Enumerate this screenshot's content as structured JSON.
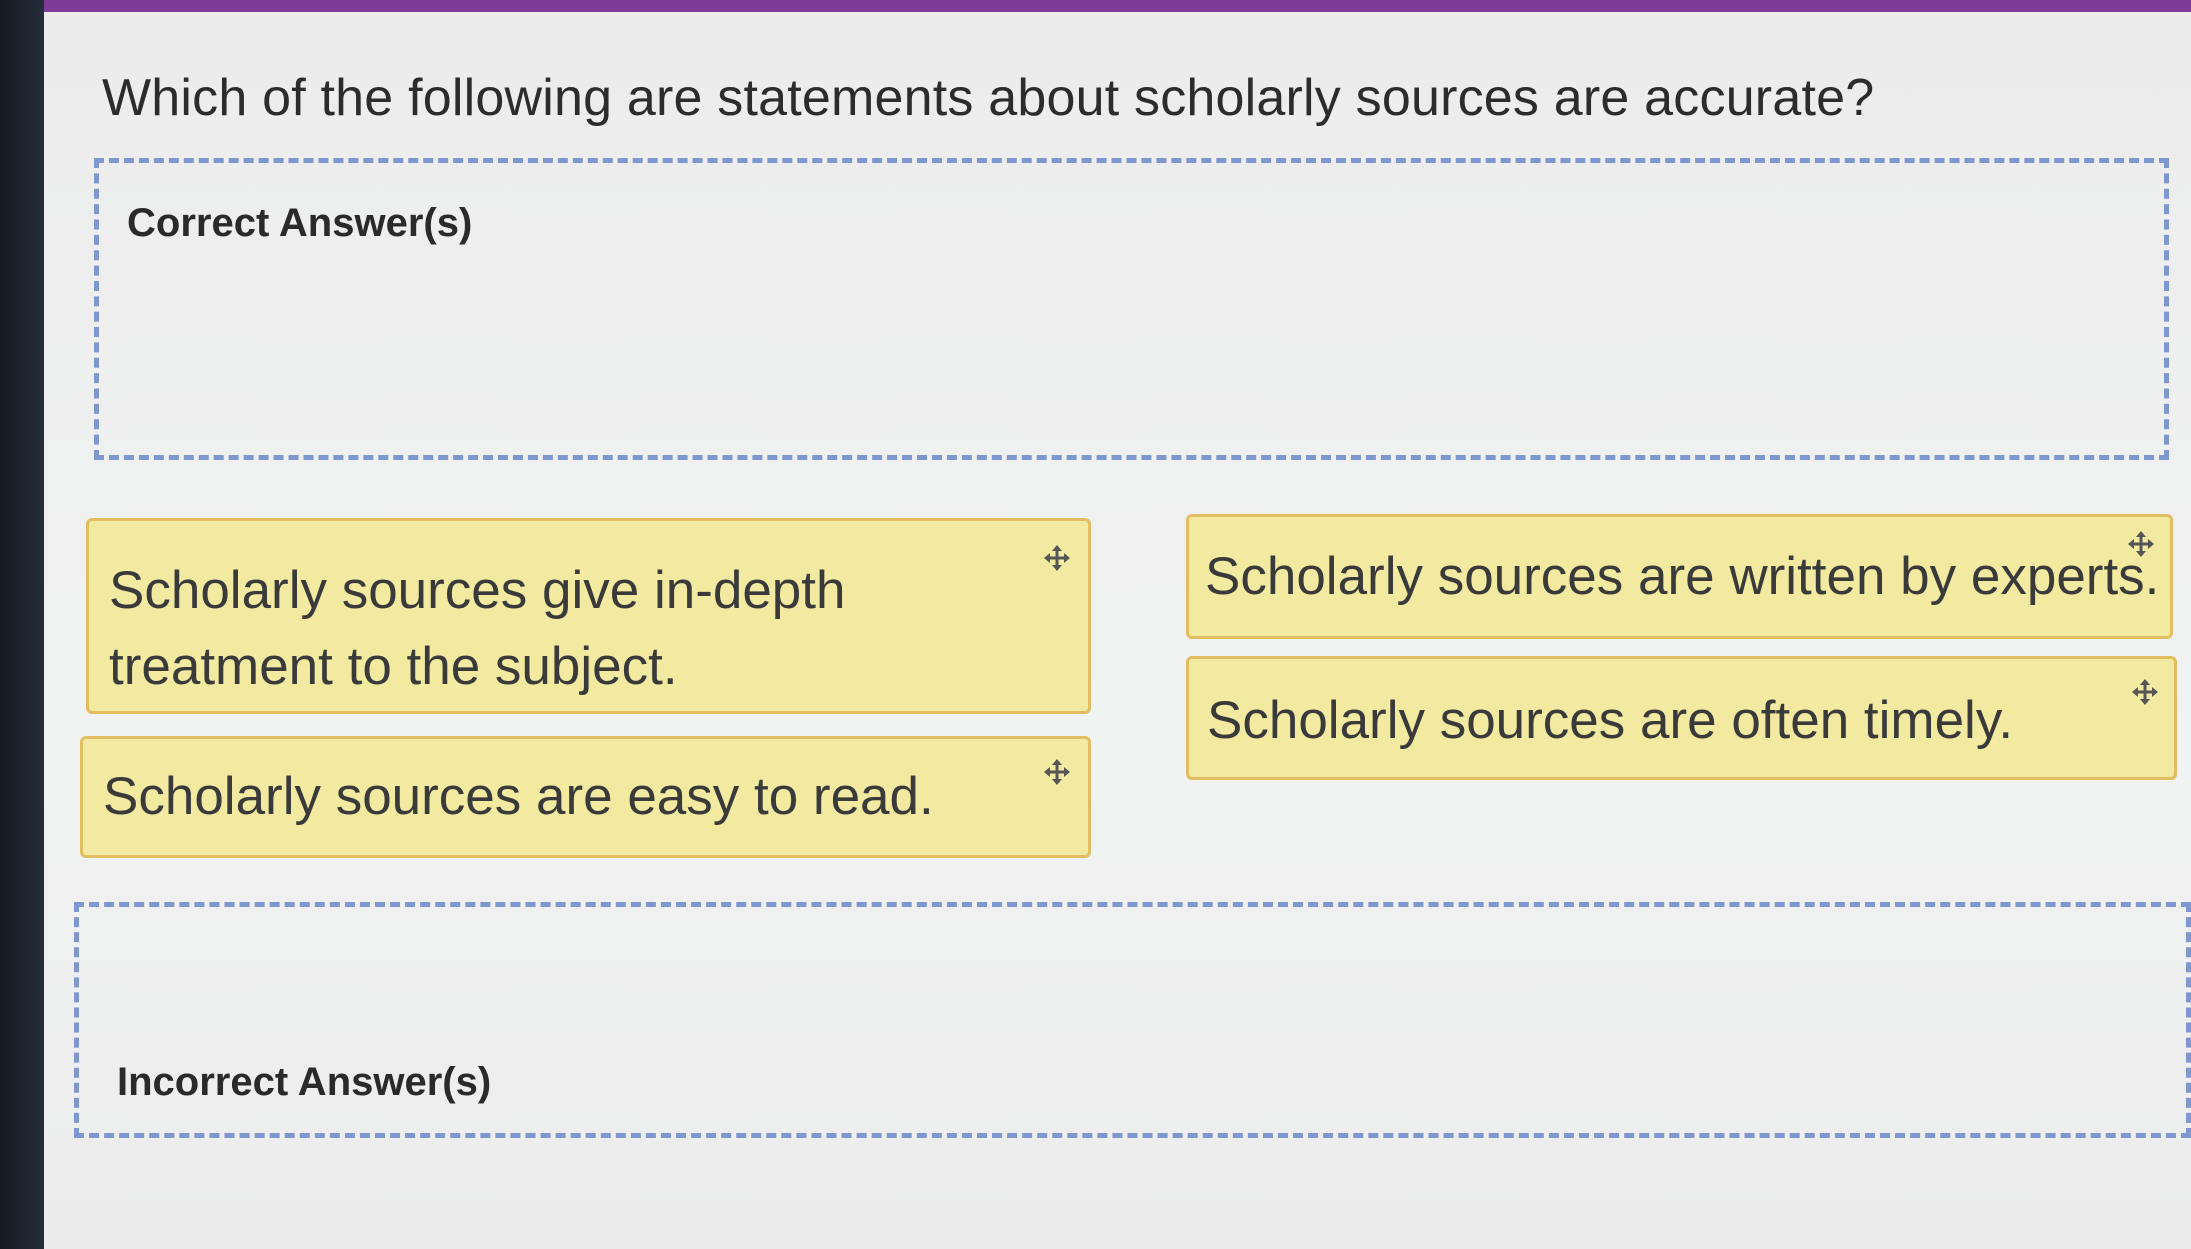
{
  "question": {
    "text": "Which of the following are statements about scholarly sources are accurate?"
  },
  "zones": {
    "correct_label": "Correct Answer(s)",
    "incorrect_label": "Incorrect Answer(s)"
  },
  "cards": [
    {
      "line1": "Scholarly sources give in-depth",
      "line2": "treatment to the subject.",
      "icon": "move-icon"
    },
    {
      "text": "Scholarly sources are easy to read.",
      "icon": "move-icon"
    },
    {
      "text": "Scholarly sources are written by experts.",
      "icon": "move-icon"
    },
    {
      "text": "Scholarly sources are often timely.",
      "icon": "move-icon"
    }
  ],
  "colors": {
    "accent_bar": "#7d3b97",
    "card_fill": "#f2eaa0",
    "card_border": "#e2bd62",
    "dropzone_border": "#7f97cf"
  }
}
